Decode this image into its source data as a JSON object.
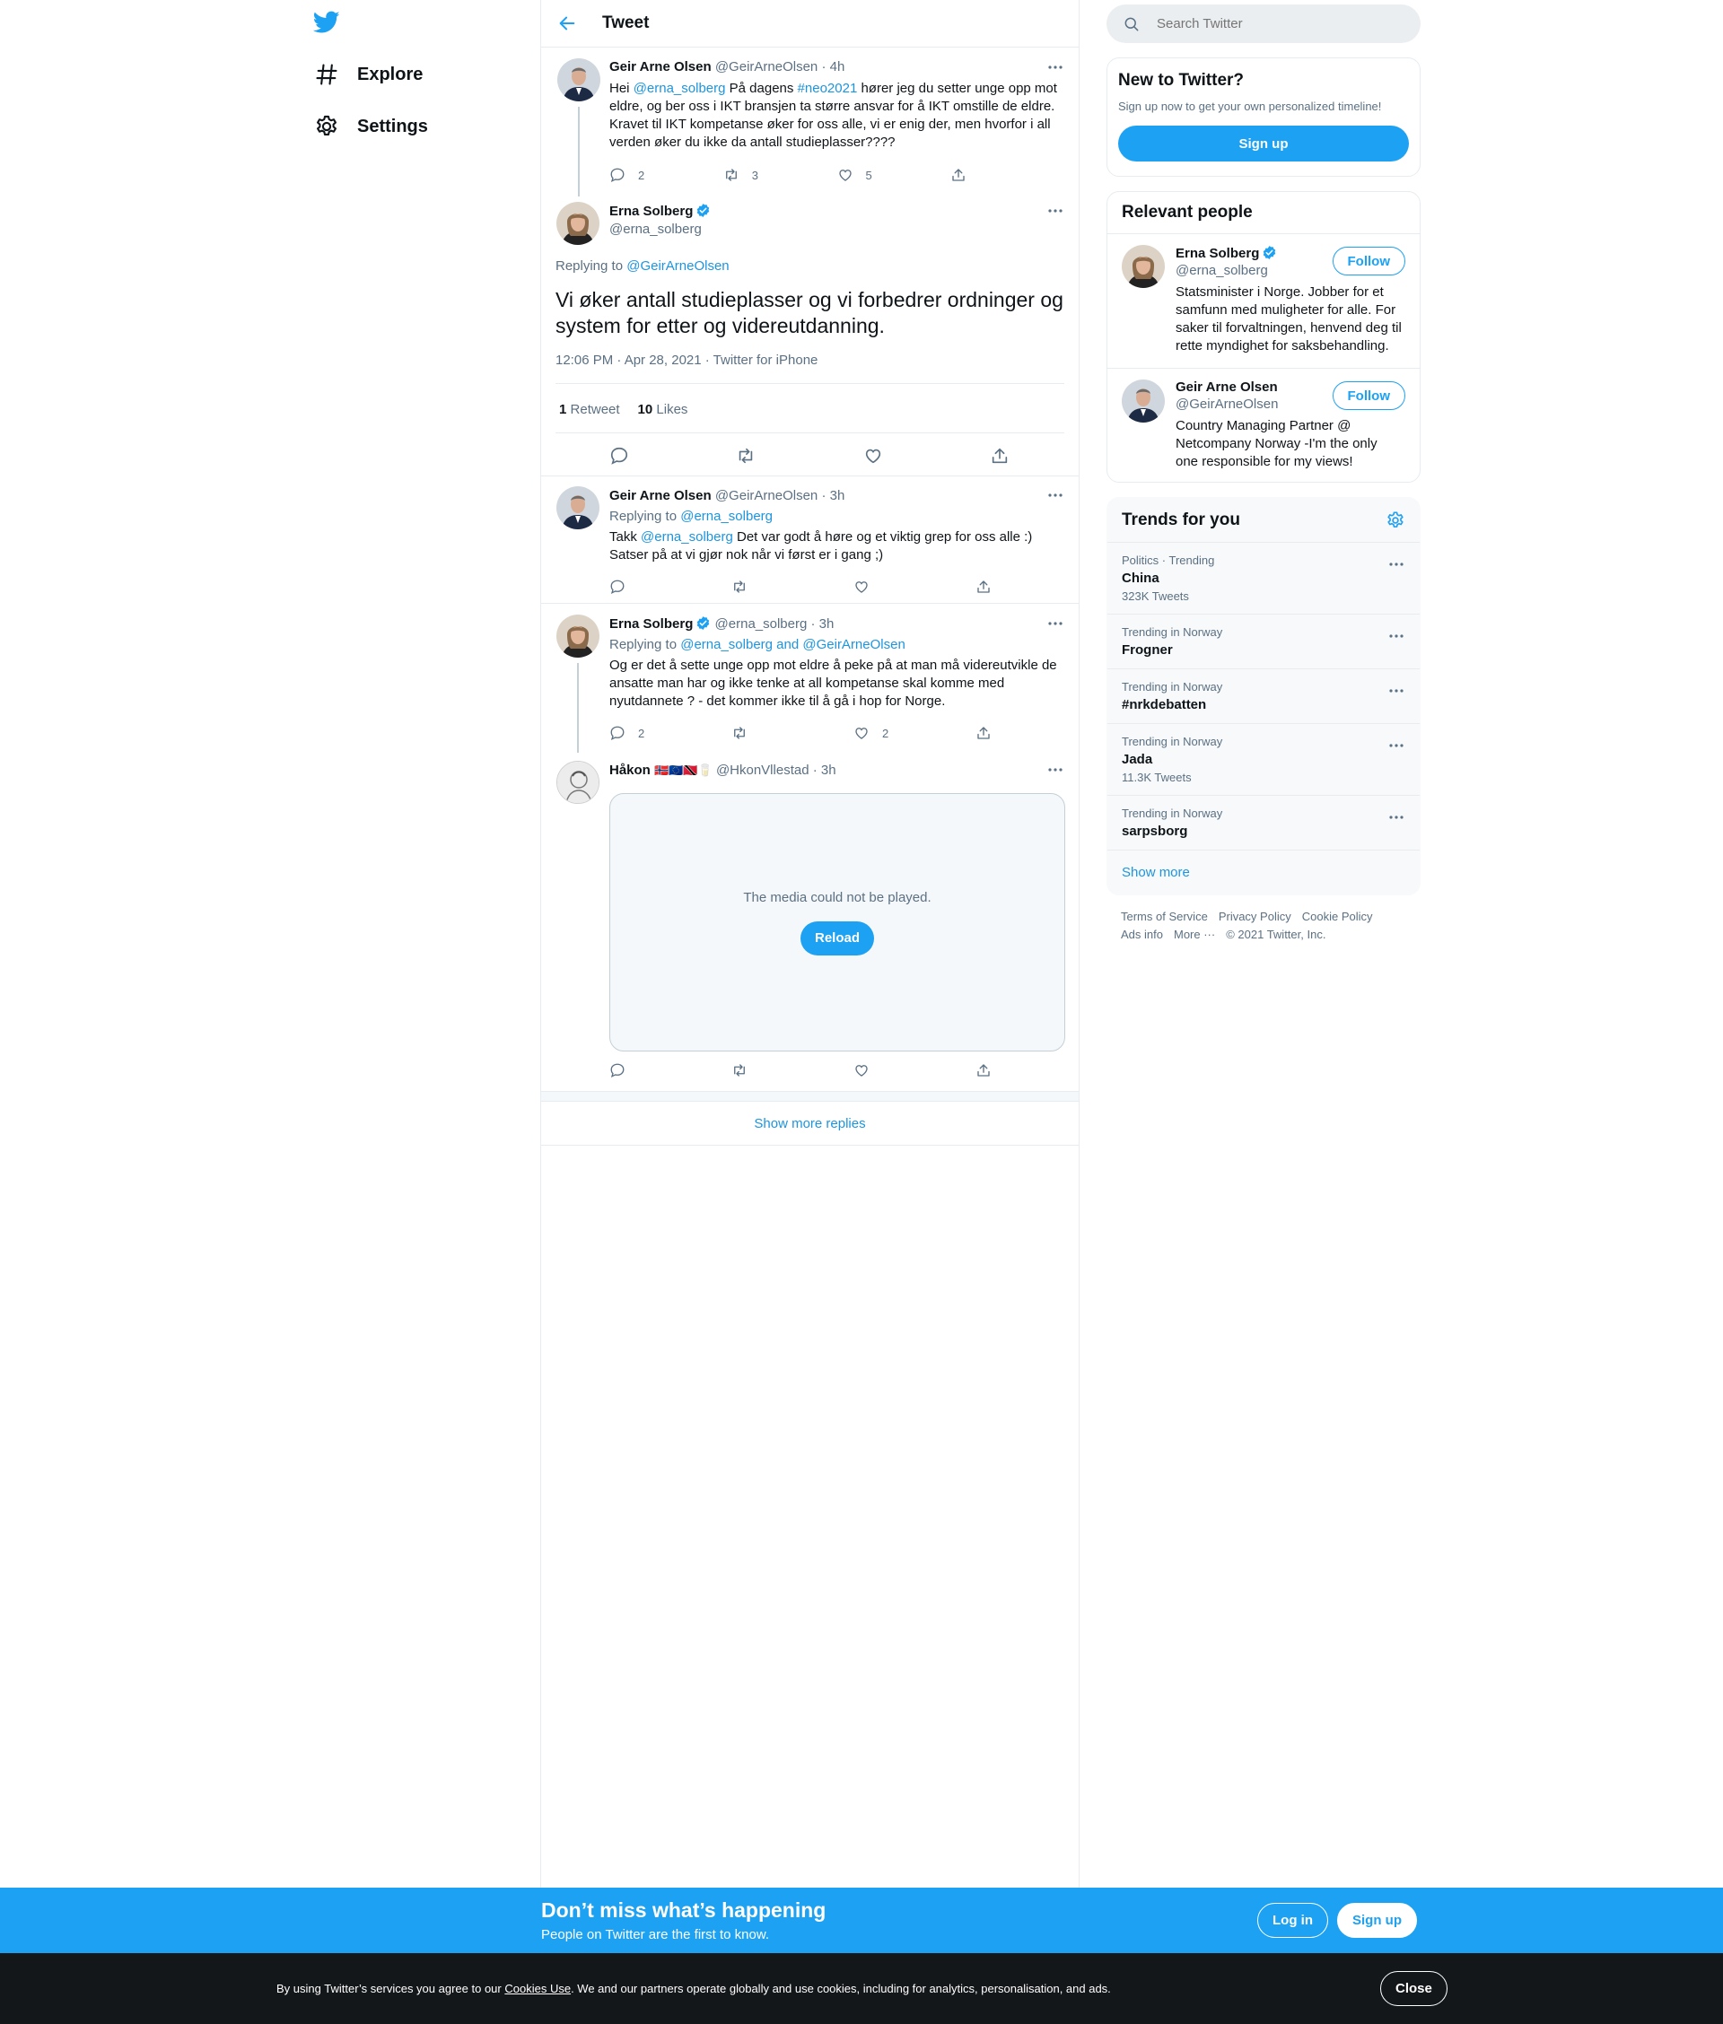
{
  "nav": {
    "logo": "twitter-bird-icon",
    "items": [
      {
        "label": "Explore",
        "icon": "hashtag-icon"
      },
      {
        "label": "Settings",
        "icon": "gear-icon"
      }
    ]
  },
  "header": {
    "title": "Tweet"
  },
  "thread": {
    "parent": {
      "name": "Geir Arne Olsen",
      "handle": "@GeirArneOlsen",
      "sep": "·",
      "time": "4h",
      "text_pre": "Hei ",
      "mention": "@erna_solberg",
      "text_mid": " På dagens ",
      "hashtag": "#neo2021",
      "text_post": " hører jeg du setter unge opp mot eldre, og ber oss i IKT bransjen ta større ansvar for å IKT omstille de eldre. Kravet til IKT kompetanse øker for oss alle, vi er enig der, men hvorfor i all verden øker du ikke da antall studieplasser????",
      "replies": "2",
      "retweets": "3",
      "likes": "5"
    },
    "focus": {
      "name": "Erna Solberg",
      "handle": "@erna_solberg",
      "replying_label": "Replying to ",
      "replying_to": "@GeirArneOlsen",
      "text": "Vi øker antall studieplasser og vi forbedrer ordninger og system for etter og videreutdanning.",
      "meta": "12:06 PM · Apr 28, 2021 · Twitter for iPhone",
      "retweet_count": "1",
      "retweet_label": "Retweet",
      "like_count": "10",
      "like_label": "Likes"
    }
  },
  "replies": [
    {
      "name": "Geir Arne Olsen",
      "handle": "@GeirArneOlsen",
      "sep": "·",
      "time": "3h",
      "replying_label": "Replying to ",
      "replying_to": "@erna_solberg",
      "text_pre": "Takk ",
      "mention": "@erna_solberg",
      "text_post": " Det var godt å høre og et viktig grep for oss alle :) Satser på at vi gjør nok når vi først er i gang ;)"
    },
    {
      "name": "Erna Solberg",
      "handle": "@erna_solberg",
      "sep": "·",
      "time": "3h",
      "replying_label": "Replying to ",
      "replying_to": "@erna_solberg and @GeirArneOlsen",
      "text": "Og er det å sette unge opp mot eldre å peke på at man må videreutvikle de ansatte man har og ikke tenke at all kompetanse skal komme med nyutdannete ? - det kommer ikke til å gå i hop for Norge.",
      "replies": "2",
      "likes": "2"
    },
    {
      "name": "Håkon",
      "emoji": "🇳🇴🇪🇺🇹🇹🥛",
      "handle": "@HkonVllestad",
      "sep": "·",
      "time": "3h",
      "media_msg": "The media could not be played.",
      "reload": "Reload"
    }
  ],
  "show_more_replies": "Show more replies",
  "sidebar": {
    "search_placeholder": "Search Twitter",
    "new": {
      "title": "New to Twitter?",
      "sub": "Sign up now to get your own personalized timeline!",
      "button": "Sign up"
    },
    "relevant": {
      "title": "Relevant people",
      "people": [
        {
          "name": "Erna Solberg",
          "handle": "@erna_solberg",
          "bio": "Statsminister i Norge. Jobber for et samfunn med muligheter for alle. For saker til forvaltningen, henvend deg til rette myndighet for saksbehandling.",
          "button": "Follow"
        },
        {
          "name": "Geir Arne Olsen",
          "handle": "@GeirArneOlsen",
          "bio": "Country Managing Partner @ Netcompany Norway -I'm the only one responsible for my views!",
          "button": "Follow"
        }
      ]
    },
    "trends": {
      "title": "Trends for you",
      "items": [
        {
          "ctx": "Politics · Trending",
          "name": "China",
          "count": "323K Tweets"
        },
        {
          "ctx": "Trending in Norway",
          "name": "Frogner",
          "count": ""
        },
        {
          "ctx": "Trending in Norway",
          "name": "#nrkdebatten",
          "count": ""
        },
        {
          "ctx": "Trending in Norway",
          "name": "Jada",
          "count": "11.3K Tweets"
        },
        {
          "ctx": "Trending in Norway",
          "name": "sarpsborg",
          "count": ""
        }
      ],
      "show_more": "Show more"
    },
    "footer": {
      "links": [
        "Terms of Service",
        "Privacy Policy",
        "Cookie Policy",
        "Ads info",
        "More ···"
      ],
      "copyright": "© 2021 Twitter, Inc."
    }
  },
  "banner": {
    "title": "Don’t miss what’s happening",
    "sub": "People on Twitter are the first to know.",
    "login": "Log in",
    "signup": "Sign up"
  },
  "cookie": {
    "pre": "By using Twitter’s services you agree to our ",
    "link": "Cookies Use",
    "post": ". We and our partners operate globally and use cookies, including for analytics, personalisation, and ads.",
    "close": "Close"
  },
  "colors": {
    "accent": "#1da1f2",
    "link": "#1b95e0",
    "muted": "#5b7083",
    "banner": "#1da1f2",
    "cookie_bg": "#14171a"
  }
}
